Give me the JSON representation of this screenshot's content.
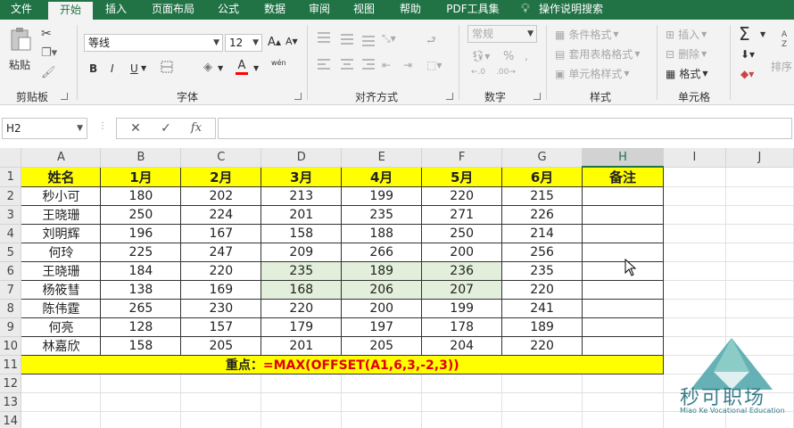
{
  "ribbon_tabs": [
    "文件",
    "开始",
    "插入",
    "页面布局",
    "公式",
    "数据",
    "审阅",
    "视图",
    "帮助",
    "PDF工具集",
    "操作说明搜索"
  ],
  "active_tab": "开始",
  "colors": {
    "accent": "#217346",
    "header_fill": "#ffff00",
    "highlight_fill": "#e2efda",
    "formula_red": "#e0000f",
    "watermark": "#3a7d8a"
  },
  "clipboard": {
    "paste_label": "粘贴",
    "group_label": "剪贴板"
  },
  "font_group": {
    "font_name": "等线",
    "font_size": "12",
    "bold": "B",
    "italic": "I",
    "underline": "U",
    "font_color_btn": "A",
    "phonetic": "wén",
    "group_label": "字体"
  },
  "align_group": {
    "group_label": "对齐方式"
  },
  "number_group": {
    "format": "常规",
    "percent": "%",
    "group_label": "数字"
  },
  "styles_group": {
    "conditional": "条件格式",
    "table_format": "套用表格格式",
    "cell_styles": "单元格样式",
    "group_label": "样式"
  },
  "cells_group": {
    "insert": "插入",
    "delete": "删除",
    "format": "格式",
    "group_label": "单元格"
  },
  "edit_group": {
    "sigma": "Σ",
    "sort": "排序"
  },
  "namebox": {
    "value": "H2"
  },
  "formula_bar": {
    "cancel": "✕",
    "enter": "✓",
    "fx": "fx",
    "value": ""
  },
  "columns": [
    "A",
    "B",
    "C",
    "D",
    "E",
    "F",
    "G",
    "H",
    "I",
    "J"
  ],
  "rows": [
    "1",
    "2",
    "3",
    "4",
    "5",
    "6",
    "7",
    "8",
    "9",
    "10",
    "11",
    "12",
    "13",
    "14"
  ],
  "table": {
    "headers": [
      "姓名",
      "1月",
      "2月",
      "3月",
      "4月",
      "5月",
      "6月",
      "备注"
    ],
    "data": [
      [
        "秒小可",
        "180",
        "202",
        "213",
        "199",
        "220",
        "215",
        ""
      ],
      [
        "王晓珊",
        "250",
        "224",
        "201",
        "235",
        "271",
        "226",
        ""
      ],
      [
        "刘明辉",
        "196",
        "167",
        "158",
        "188",
        "250",
        "214",
        ""
      ],
      [
        "何玲",
        "225",
        "247",
        "209",
        "266",
        "200",
        "256",
        ""
      ],
      [
        "王晓珊",
        "184",
        "220",
        "235",
        "189",
        "236",
        "235",
        ""
      ],
      [
        "杨筱彗",
        "138",
        "169",
        "168",
        "206",
        "207",
        "220",
        ""
      ],
      [
        "陈伟霆",
        "265",
        "230",
        "220",
        "200",
        "199",
        "241",
        ""
      ],
      [
        "何亮",
        "128",
        "157",
        "179",
        "197",
        "178",
        "189",
        ""
      ],
      [
        "林嘉欣",
        "158",
        "205",
        "201",
        "205",
        "204",
        "220",
        ""
      ]
    ]
  },
  "note_row": {
    "label": "重点：",
    "formula": "=MAX(OFFSET(A1,6,3,-2,3))"
  },
  "watermark": {
    "name": "秒可职场",
    "sub": "Miao Ke Vocational Education"
  }
}
